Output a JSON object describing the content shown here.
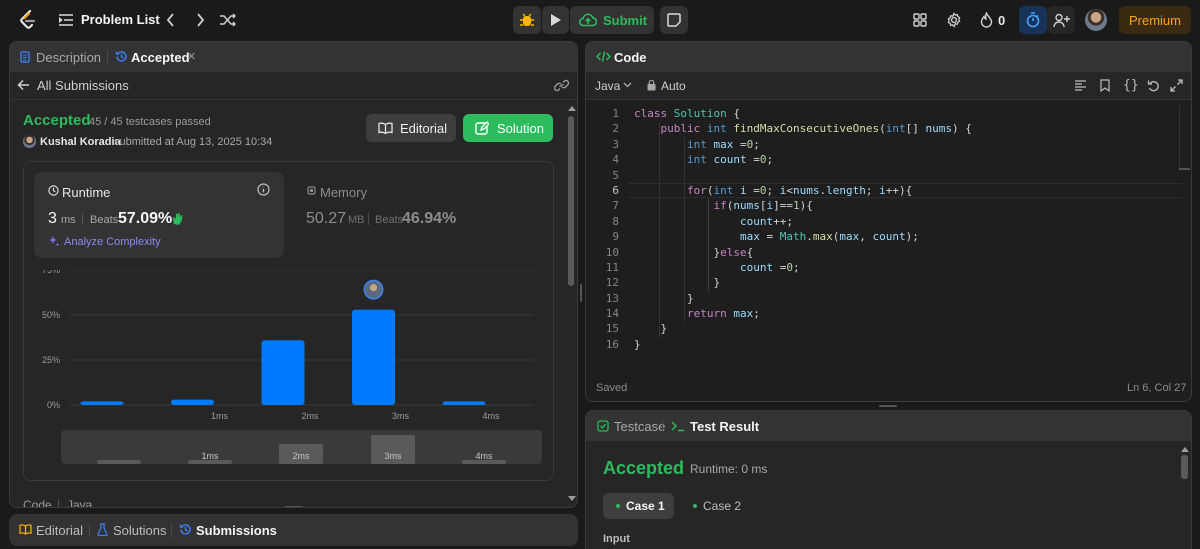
{
  "topbar": {
    "problem_list": "Problem List",
    "submit": "Submit",
    "streak_count": "0",
    "premium": "Premium",
    "icons": [
      "logo-icon",
      "list-icon",
      "chevron-left-icon",
      "chevron-right-icon",
      "shuffle-icon",
      "debug-icon",
      "play-icon",
      "cloud-upload-icon",
      "note-icon",
      "grid-icon",
      "gear-icon",
      "fire-icon",
      "timer-icon",
      "add-user-icon",
      "avatar"
    ]
  },
  "left": {
    "tabs": {
      "description": "Description",
      "accepted": "Accepted"
    },
    "all_submissions": "All Submissions",
    "status": "Accepted",
    "testcases": "45 / 45 testcases passed",
    "user": "Kushal Koradia",
    "submitted_at": "submitted at Aug 13, 2025 10:34",
    "editorial_btn": "Editorial",
    "solution_btn": "Solution",
    "runtime": {
      "label": "Runtime",
      "value": "3",
      "unit": "ms",
      "beats_label": "Beats",
      "beats": "57.09%"
    },
    "memory": {
      "label": "Memory",
      "value": "50.27",
      "unit": "MB",
      "beats_label": "Beats",
      "beats": "46.94%"
    },
    "analyze": "Analyze Complexity",
    "code_label": "Code",
    "lang_label": "Java",
    "bottom_tabs": {
      "editorial": "Editorial",
      "solutions": "Solutions",
      "submissions": "Submissions"
    }
  },
  "chart_data": {
    "type": "bar",
    "y_ticks": [
      "75%",
      "50%",
      "25%",
      "0%"
    ],
    "ylim": [
      0,
      75
    ],
    "categories": [
      "",
      "1ms",
      "2ms",
      "3ms",
      "4ms"
    ],
    "values": [
      2,
      3,
      36,
      53,
      2
    ],
    "highlight": "3ms",
    "bar_color": "#007aff",
    "grid": true
  },
  "code": {
    "title": "Code",
    "language": "Java",
    "mode": "Auto",
    "saved": "Saved",
    "cursor": "Ln 6, Col 27",
    "line_numbers": [
      "1",
      "2",
      "3",
      "4",
      "5",
      "6",
      "7",
      "8",
      "9",
      "10",
      "11",
      "12",
      "13",
      "14",
      "15",
      "16"
    ]
  },
  "test": {
    "testcase_tab": "Testcase",
    "result_tab": "Test Result",
    "status": "Accepted",
    "runtime": "Runtime: 0 ms",
    "case1": "Case 1",
    "case2": "Case 2",
    "input_label": "Input"
  }
}
